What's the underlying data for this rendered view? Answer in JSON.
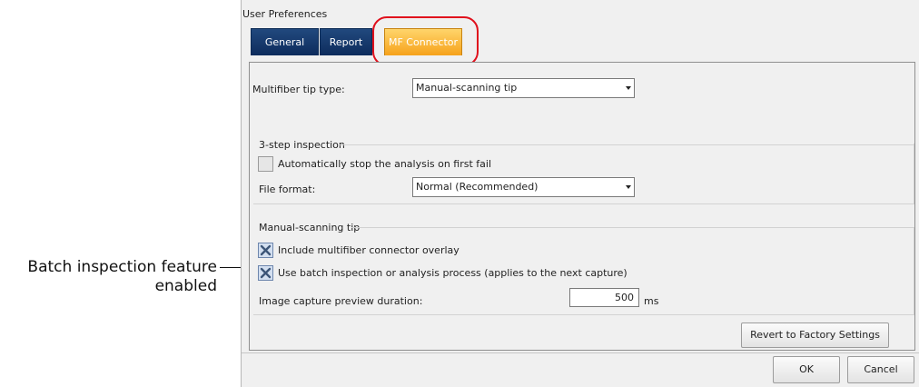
{
  "callout": {
    "text_line1": "Batch inspection feature",
    "text_line2": "enabled"
  },
  "dialog": {
    "title": "User Preferences",
    "tabs": [
      {
        "label": "General",
        "active": false
      },
      {
        "label": "Report",
        "active": false
      },
      {
        "label": "MF Connector",
        "active": true
      }
    ],
    "tip_type": {
      "label": "Multifiber tip type:",
      "value": "Manual-scanning tip"
    },
    "three_step": {
      "title": "3-step inspection",
      "auto_stop": {
        "label": "Automatically stop the analysis on first fail",
        "checked": false
      },
      "file_format": {
        "label": "File format:",
        "value": "Normal (Recommended)"
      }
    },
    "manual_scanning": {
      "title": "Manual-scanning tip",
      "overlay": {
        "label": "Include multifiber connector overlay",
        "checked": true
      },
      "batch": {
        "label": "Use batch inspection or analysis process (applies to the next capture)",
        "checked": true
      },
      "preview": {
        "label": "Image capture preview duration:",
        "value": "500",
        "unit": "ms"
      }
    },
    "buttons": {
      "revert": "Revert to Factory Settings",
      "ok": "OK",
      "cancel": "Cancel"
    }
  },
  "colors": {
    "tab_inactive": "#0d2c5c",
    "tab_active": "#f6a21b",
    "highlight": "#e0101c"
  },
  "icons": {
    "checkbox_checked": "x-check-icon",
    "combo_arrow": "chevron-down-icon"
  }
}
